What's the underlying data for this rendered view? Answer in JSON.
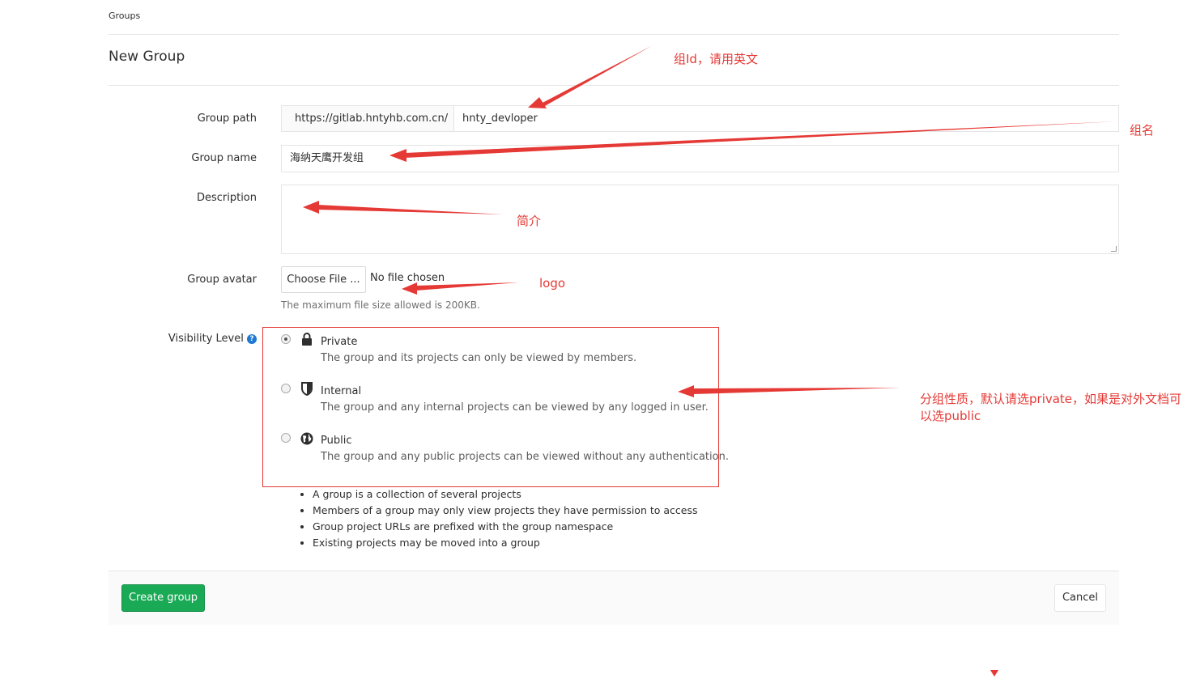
{
  "breadcrumb": "Groups",
  "page_title": "New Group",
  "form": {
    "path_label": "Group path",
    "path_prefix": "https://gitlab.hntyhb.com.cn/",
    "path_value": "hnty_devloper",
    "name_label": "Group name",
    "name_value": "海纳天鹰开发组",
    "description_label": "Description",
    "description_value": "",
    "avatar_label": "Group avatar",
    "choose_file": "Choose File ...",
    "no_file": "No file chosen",
    "max_size_help": "The maximum file size allowed is 200KB.",
    "visibility_label": "Visibility Level",
    "visibility_options": [
      {
        "title": "Private",
        "desc": "The group and its projects can only be viewed by members.",
        "icon": "lock-icon",
        "checked": true
      },
      {
        "title": "Internal",
        "desc": "The group and any internal projects can be viewed by any logged in user.",
        "icon": "shield-icon",
        "checked": false
      },
      {
        "title": "Public",
        "desc": "The group and any public projects can be viewed without any authentication.",
        "icon": "globe-icon",
        "checked": false
      }
    ]
  },
  "info_list": [
    "A group is a collection of several projects",
    "Members of a group may only view projects they have permission to access",
    "Group project URLs are prefixed with the group namespace",
    "Existing projects may be moved into a group"
  ],
  "buttons": {
    "create": "Create group",
    "cancel": "Cancel"
  },
  "annotations": {
    "group_id": "组Id，请用英文",
    "group_name": "组名",
    "description": "简介",
    "logo": "logo",
    "visibility_line1": "分组性质，默认请选private，如果是对外文档可",
    "visibility_line2": "以选public"
  },
  "colors": {
    "annotation_red": "#e53935",
    "create_green": "#1aaa55",
    "help_blue": "#1f78d1"
  }
}
